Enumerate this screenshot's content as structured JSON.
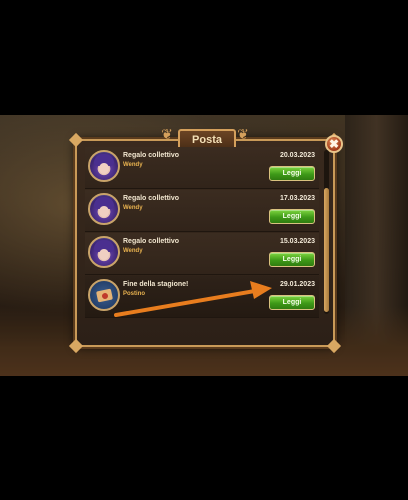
{
  "window": {
    "title": "Posta"
  },
  "close_symbol": "✖",
  "ornament_symbol": "❦",
  "messages": [
    {
      "title": "Regalo collettivo",
      "sender": "Wendy",
      "date": "20.03.2023",
      "button": "Leggi",
      "icon": "wendy-avatar-icon"
    },
    {
      "title": "Regalo collettivo",
      "sender": "Wendy",
      "date": "17.03.2023",
      "button": "Leggi",
      "icon": "wendy-avatar-icon"
    },
    {
      "title": "Regalo collettivo",
      "sender": "Wendy",
      "date": "15.03.2023",
      "button": "Leggi",
      "icon": "wendy-avatar-icon"
    },
    {
      "title": "Fine della stagione!",
      "sender": "Postino",
      "date": "29.01.2023",
      "button": "Leggi",
      "icon": "envelope-icon"
    }
  ],
  "colors": {
    "accent_gold": "#c99a58",
    "button_green": "#3e9a18",
    "sender_orange": "#e8b24f",
    "annotation_arrow": "#e87d1e"
  }
}
